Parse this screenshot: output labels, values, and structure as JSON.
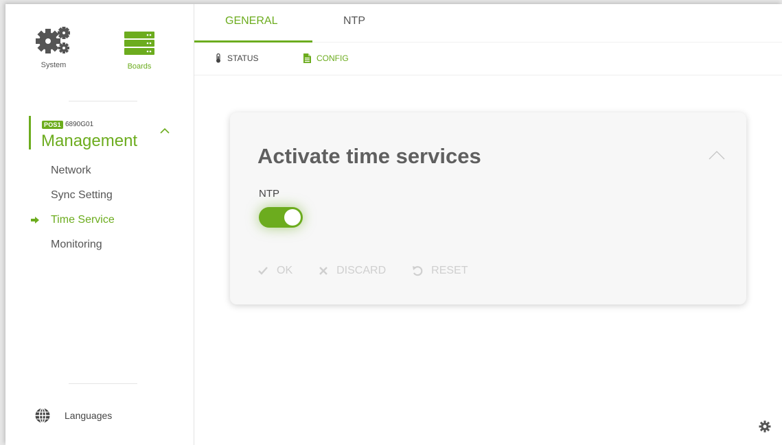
{
  "sidebar": {
    "nav": {
      "system_label": "System",
      "boards_label": "Boards"
    },
    "pos_badge": "POS1",
    "pos_code": "6890G01",
    "section_title": "Management",
    "items": [
      {
        "label": "Network"
      },
      {
        "label": "Sync Setting"
      },
      {
        "label": "Time Service"
      },
      {
        "label": "Monitoring"
      }
    ],
    "languages_label": "Languages"
  },
  "main": {
    "tabs": [
      {
        "label": "GENERAL"
      },
      {
        "label": "NTP"
      }
    ],
    "subtabs": [
      {
        "label": "STATUS"
      },
      {
        "label": "CONFIG"
      }
    ],
    "card": {
      "title": "Activate time services",
      "ntp_label": "NTP",
      "ntp_enabled": true,
      "actions": {
        "ok": "OK",
        "discard": "DISCARD",
        "reset": "RESET"
      }
    }
  },
  "colors": {
    "accent": "#6cac1e",
    "text": "#555555",
    "disabled": "#cfcfcf"
  },
  "icons": [
    "gears-icon",
    "boards-icon",
    "chevron-up-icon",
    "arrow-right-icon",
    "globe-icon",
    "thermometer-icon",
    "document-icon",
    "check-icon",
    "close-icon",
    "undo-icon",
    "settings-icon"
  ]
}
